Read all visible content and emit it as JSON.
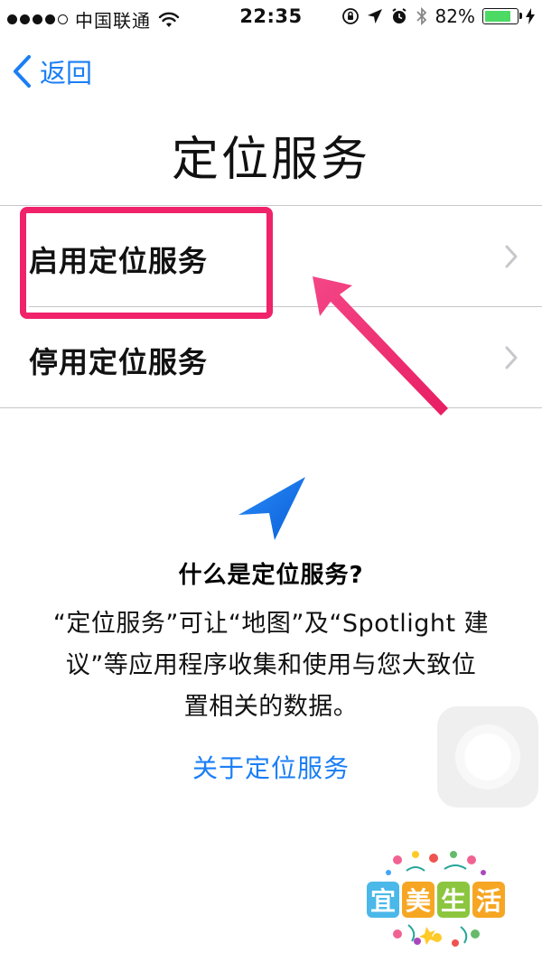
{
  "status_bar": {
    "carrier": "中国联通",
    "time": "22:35",
    "battery_percent": "82%",
    "battery_level": 0.82,
    "signal_icon": "signal-dots-icon",
    "wifi_icon": "wifi-icon",
    "rotation_lock_icon": "rotation-lock-icon",
    "location_icon": "location-arrow-icon",
    "alarm_icon": "alarm-icon",
    "bluetooth_icon": "bluetooth-icon"
  },
  "nav": {
    "back_label": "返回",
    "back_icon": "chevron-left-icon",
    "accent_color": "#1a7ef5"
  },
  "page": {
    "title": "定位服务"
  },
  "options": [
    {
      "label": "启用定位服务",
      "icon": "chevron-right-icon"
    },
    {
      "label": "停用定位服务",
      "icon": "chevron-right-icon"
    }
  ],
  "annotation": {
    "highlight_color": "#f0226a",
    "arrow_icon": "pointer-arrow-icon"
  },
  "help": {
    "icon": "location-services-icon",
    "heading": "什么是定位服务?",
    "body_lines": [
      "“定位服务”可让“地图”及“Spotlight 建",
      "议”等应用程序收集和使用与您大致位",
      "置相关的数据。"
    ],
    "link": "关于定位服务"
  },
  "assistive_touch": {
    "icon": "assistive-touch-icon"
  },
  "watermark": {
    "text": "宜美生活",
    "chars": [
      "宜",
      "美",
      "生",
      "活"
    ],
    "colors": [
      "#4ab8e8",
      "#f6a623",
      "#8cc63f",
      "#f6a623"
    ]
  }
}
